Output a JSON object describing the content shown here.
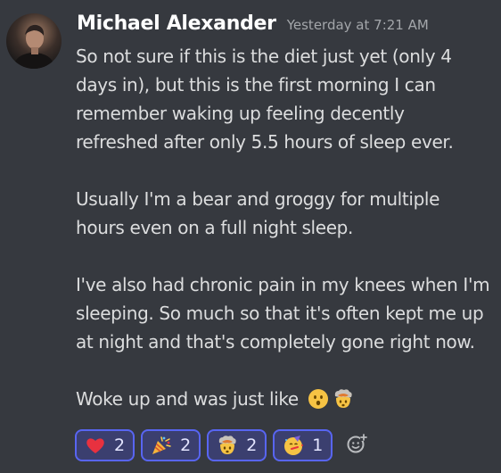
{
  "message": {
    "author": "Michael Alexander",
    "timestamp": "Yesterday at 7:21 AM",
    "paragraphs": [
      [
        "So not sure if this is the diet just yet (only 4",
        "days in), but this is the first morning I can",
        "remember waking up feeling decently",
        "refreshed after only 5.5 hours of sleep ever."
      ],
      [
        "Usually I'm a bear and groggy for multiple",
        "hours even on a full night sleep."
      ],
      [
        "I've also had chronic pain in my knees when I'm",
        "sleeping. So much so that it's often kept me up",
        "at night and that's completely gone right now."
      ],
      [
        "Woke up and was just like"
      ]
    ],
    "inline_emojis": [
      "hushed-face-icon",
      "exploding-head-icon"
    ]
  },
  "reactions": [
    {
      "emoji": "red-heart-icon",
      "count": "2",
      "color": "#e8313f"
    },
    {
      "emoji": "party-popper-icon",
      "count": "2",
      "color": "#f5b43b"
    },
    {
      "emoji": "exploding-head-icon",
      "count": "2",
      "color": "#f6c344"
    },
    {
      "emoji": "partying-face-icon",
      "count": "1",
      "color": "#f6c344"
    }
  ],
  "add_reaction_icon": "add-reaction-icon",
  "colors": {
    "background": "#36393f",
    "username": "#ffffff",
    "timestamp": "#a3a6aa",
    "text": "#dcddde",
    "reaction_border": "#5865f2",
    "reaction_bg": "#3b3f6f"
  }
}
